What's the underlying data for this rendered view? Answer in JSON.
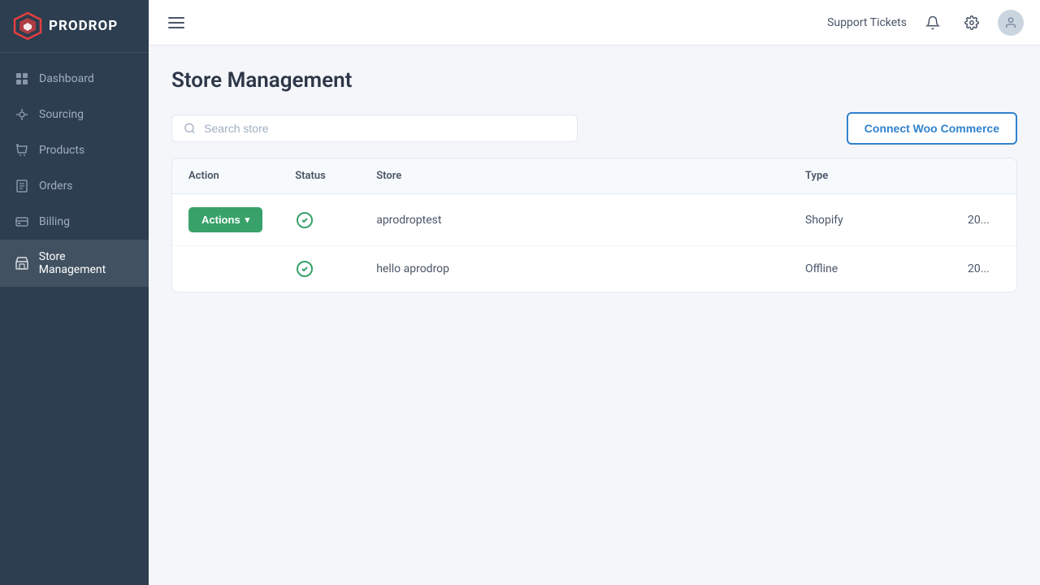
{
  "app": {
    "name": "PRODROP"
  },
  "header": {
    "hamburger_label": "Toggle menu",
    "support_label": "Support Tickets",
    "notifications_icon": "bell",
    "settings_icon": "gear",
    "user_icon": "user-avatar"
  },
  "sidebar": {
    "items": [
      {
        "id": "dashboard",
        "label": "Dashboard",
        "icon": "dashboard-icon",
        "active": false
      },
      {
        "id": "sourcing",
        "label": "Sourcing",
        "icon": "sourcing-icon",
        "active": false
      },
      {
        "id": "products",
        "label": "Products",
        "icon": "products-icon",
        "active": false
      },
      {
        "id": "orders",
        "label": "Orders",
        "icon": "orders-icon",
        "active": false
      },
      {
        "id": "billing",
        "label": "Billing",
        "icon": "billing-icon",
        "active": false
      },
      {
        "id": "store-management",
        "label": "Store Management",
        "icon": "store-icon",
        "active": true
      }
    ]
  },
  "page": {
    "title": "Store Management",
    "search_placeholder": "Search store",
    "connect_button": "Connect Woo Commerce"
  },
  "table": {
    "columns": [
      "Action",
      "Status",
      "Store",
      "Type",
      ""
    ],
    "rows": [
      {
        "action_label": "Actions",
        "status": "active",
        "store": "aprodroptest",
        "type": "Shopify",
        "date": "20..."
      },
      {
        "action_label": null,
        "status": "active",
        "store": "hello aprodrop",
        "type": "Offline",
        "date": "20..."
      }
    ]
  }
}
